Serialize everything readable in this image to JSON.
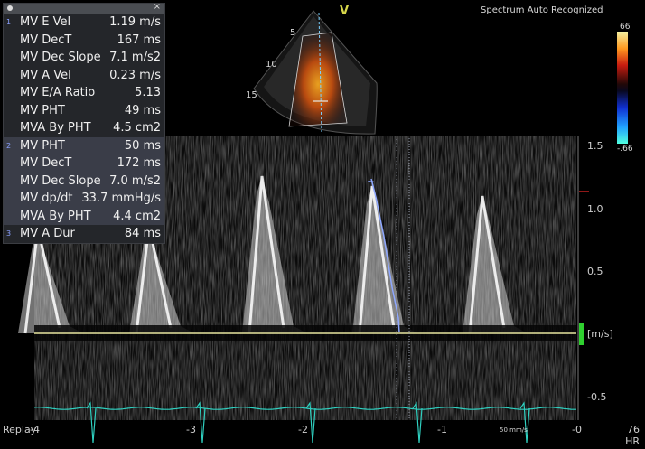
{
  "header": {
    "mode_letter": "V",
    "status": "Spectrum Auto Recognized"
  },
  "color_bar": {
    "top": "66",
    "bottom": "-.66"
  },
  "sector_depths": [
    "5",
    "10",
    "15"
  ],
  "measurements": [
    {
      "idx": "1",
      "label": "MV E Vel",
      "value": "1.19 m/s"
    },
    {
      "idx": "",
      "label": "MV DecT",
      "value": "167 ms"
    },
    {
      "idx": "",
      "label": "MV Dec Slope",
      "value": "7.1 m/s2"
    },
    {
      "idx": "",
      "label": "MV A Vel",
      "value": "0.23 m/s"
    },
    {
      "idx": "",
      "label": "MV E/A Ratio",
      "value": "5.13"
    },
    {
      "idx": "",
      "label": "MV PHT",
      "value": "49 ms"
    },
    {
      "idx": "",
      "label": "MVA By PHT",
      "value": "4.5 cm2"
    },
    {
      "idx": "2",
      "label": "MV PHT",
      "value": "50 ms"
    },
    {
      "idx": "",
      "label": "MV DecT",
      "value": "172 ms"
    },
    {
      "idx": "",
      "label": "MV Dec Slope",
      "value": "7.0 m/s2"
    },
    {
      "idx": "",
      "label": "MV dp/dt",
      "value": "33.7 mmHg/s"
    },
    {
      "idx": "",
      "label": "MVA By PHT",
      "value": "4.4 cm2"
    },
    {
      "idx": "3",
      "label": "MV A Dur",
      "value": "84 ms"
    }
  ],
  "velocity_ticks": [
    "1.5",
    "1.0",
    "0.5",
    "[m/s]",
    "-0.5"
  ],
  "time_ticks": [
    "-4",
    "-3",
    "-2",
    "-1",
    "-0"
  ],
  "replay_label": "Replay",
  "sweep_speed": "50 mm/s",
  "heart_rate": {
    "value": "76",
    "unit": "HR"
  },
  "colors": {
    "baseline": "#e8e6a0",
    "ecg": "#2fd0c0",
    "marker": "#2fd02f",
    "trace": "#8fa8ff"
  }
}
